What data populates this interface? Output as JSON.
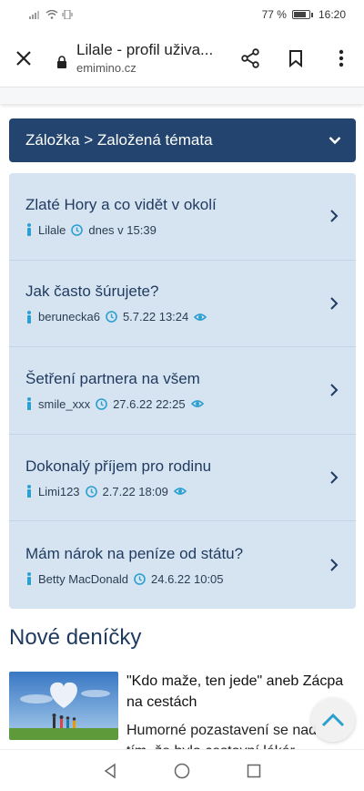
{
  "status": {
    "percent": "77 %",
    "time": "16:20"
  },
  "browser": {
    "title": "Lilale - profil uživa...",
    "domain": "emimino.cz"
  },
  "header": {
    "label": "Záložka > Založená témata"
  },
  "topics": [
    {
      "title": "Zlaté Hory a co vidět v okolí",
      "user": "Lilale",
      "date": "dnes v 15:39",
      "viewed": false
    },
    {
      "title": "Jak často šúrujete?",
      "user": "berunecka6",
      "date": "5.7.22 13:24",
      "viewed": true
    },
    {
      "title": "Šetření partnera na všem",
      "user": "smile_xxx",
      "date": "27.6.22 22:25",
      "viewed": true
    },
    {
      "title": "Dokonalý příjem pro rodinu",
      "user": "Limi123",
      "date": "2.7.22 18:09",
      "viewed": true
    },
    {
      "title": "Mám nárok na peníze od státu?",
      "user": "Betty MacDonald",
      "date": "24.6.22 10:05",
      "viewed": false
    }
  ],
  "diaries": {
    "title": "Nové deníčky",
    "card": {
      "title": "\"Kdo maže, ten jede\" aneb Zácpa na cestách",
      "desc": "Humorné pozastavení se nad tím, že bylo cestovní lékár"
    }
  },
  "colors": {
    "header": "#22446e",
    "list": "#d6e4f1",
    "accent": "#2a9fd0"
  }
}
